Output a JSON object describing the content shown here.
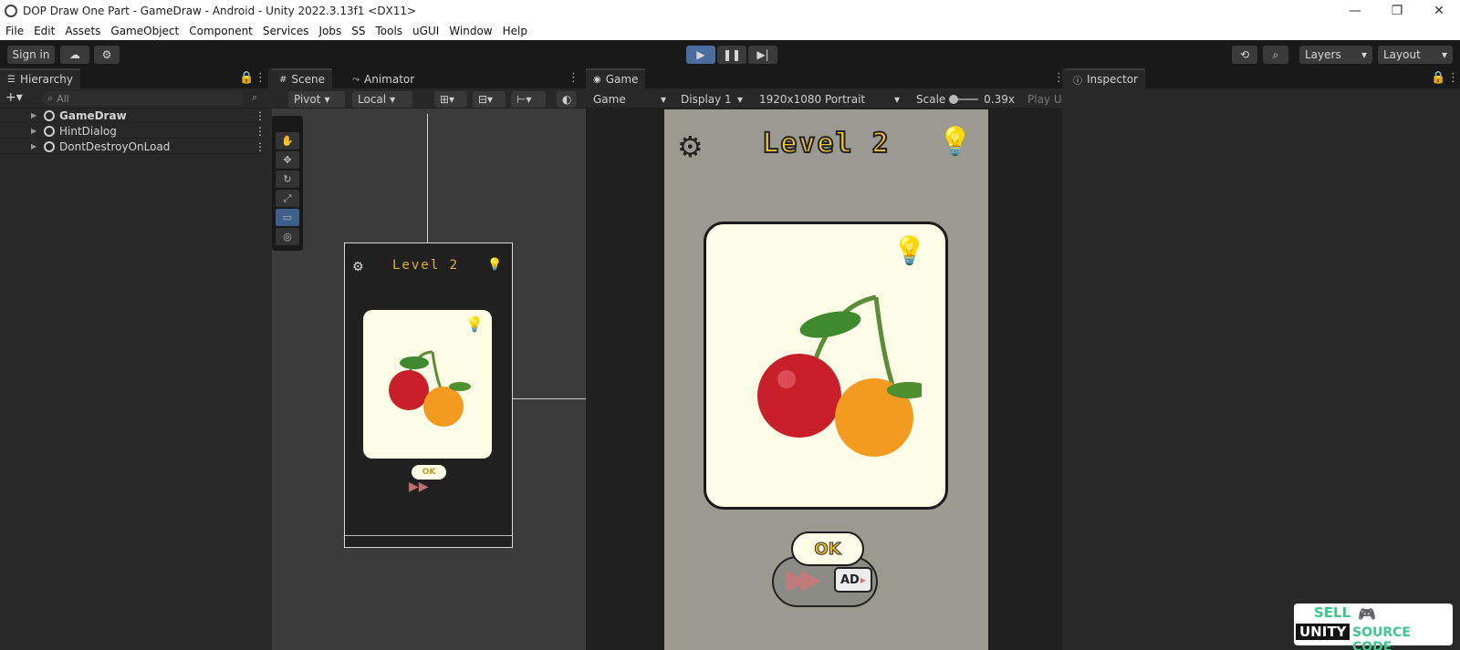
{
  "window": {
    "title": "DOP Draw One Part - GameDraw - Android - Unity 2022.3.13f1 <DX11>"
  },
  "menu": {
    "items": [
      "File",
      "Edit",
      "Assets",
      "GameObject",
      "Component",
      "Services",
      "Jobs",
      "SS",
      "Tools",
      "uGUI",
      "Window",
      "Help"
    ]
  },
  "toolbar": {
    "sign_in": "Sign in",
    "layers": "Layers",
    "layout": "Layout"
  },
  "hierarchy": {
    "tab": "Hierarchy",
    "search_placeholder": "All",
    "items": [
      {
        "label": "GameDraw"
      },
      {
        "label": "HintDialog"
      },
      {
        "label": "DontDestroyOnLoad"
      }
    ]
  },
  "scene": {
    "tab_scene": "Scene",
    "tab_animator": "Animator",
    "pivot": "Pivot",
    "local": "Local",
    "mini_title": "Level 2",
    "mini_ok": "OK"
  },
  "game": {
    "tab": "Game",
    "mode": "Game",
    "display": "Display 1",
    "resolution": "1920x1080 Portrait",
    "scale_label": "Scale",
    "scale_value": "0.39x",
    "play_unfocused": "Play Ur",
    "level_title": "Level 2",
    "ok_label": "OK",
    "ad_label": "AD"
  },
  "inspector": {
    "tab": "Inspector"
  },
  "watermark": {
    "line1": "SELL",
    "line2": "UNITY",
    "line3": "SOURCE CODE"
  },
  "colors": {
    "accent": "#4a6d9e",
    "level_title": "#f2c33b",
    "card_bg": "#fdfde7",
    "game_bg": "#9a9a90"
  }
}
